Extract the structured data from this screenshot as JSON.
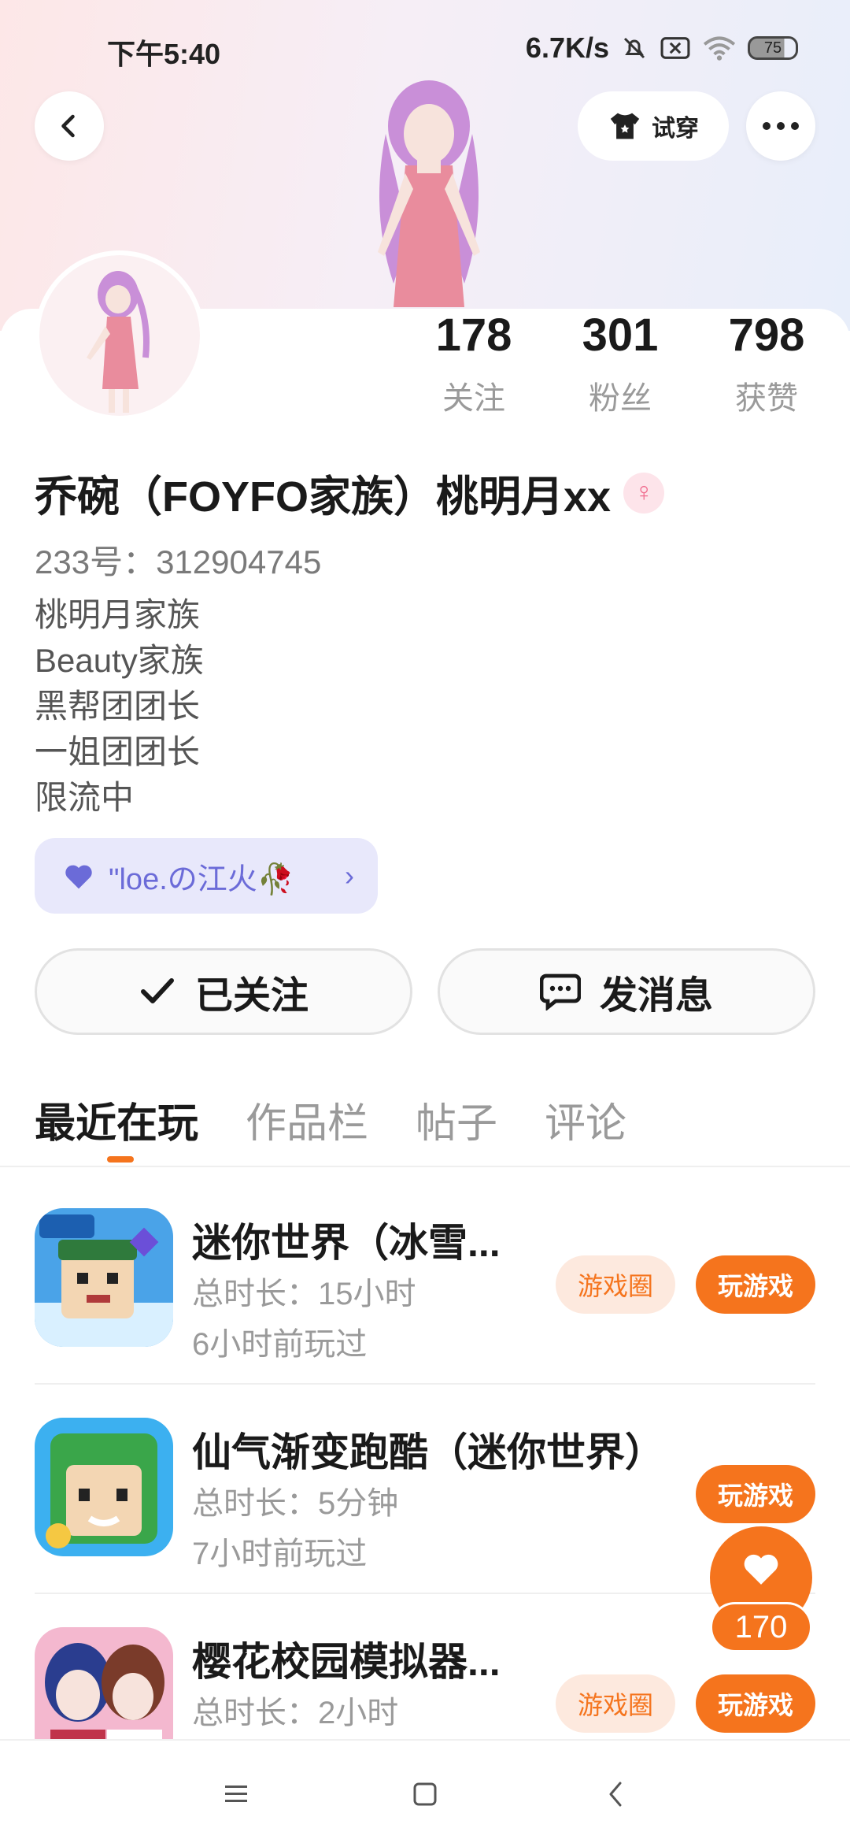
{
  "status_bar": {
    "time": "下午5:40",
    "net_speed": "6.7K/s",
    "battery": "75"
  },
  "header": {
    "tryon_label": "试穿"
  },
  "stats": [
    {
      "value": "178",
      "label": "关注"
    },
    {
      "value": "301",
      "label": "粉丝"
    },
    {
      "value": "798",
      "label": "获赞"
    }
  ],
  "profile": {
    "name": "乔碗（FOYFO家族）桃明月xx",
    "gender_symbol": "♀",
    "uid": "233号：312904745",
    "bio": [
      "桃明月家族",
      "Beauty家族",
      "黑帮团团长",
      "一姐团团长",
      "限流中"
    ],
    "fan_badge": "\"loe.の江火🥀"
  },
  "actions": {
    "followed_label": "已关注",
    "message_label": "发消息"
  },
  "tabs": [
    "最近在玩",
    "作品栏",
    "帖子",
    "评论"
  ],
  "games": [
    {
      "title": "迷你世界（冰雪...",
      "duration": "总时长：15小时",
      "last_played": "6小时前玩过",
      "circle_label": "游戏圈",
      "play_label": "玩游戏"
    },
    {
      "title": "仙气渐变跑酷（迷你世界）",
      "duration": "总时长：5分钟",
      "last_played": "7小时前玩过",
      "play_label": "玩游戏"
    },
    {
      "title": "樱花校园模拟器...",
      "duration": "总时长：2小时",
      "last_played": "",
      "circle_label": "游戏圈",
      "play_label": "玩游戏"
    }
  ],
  "like_count": "170",
  "colors": {
    "accent": "#f5741d",
    "accent_light": "#fde9de",
    "badge_bg": "#e8e8fb",
    "badge_text": "#6b6bd8"
  }
}
